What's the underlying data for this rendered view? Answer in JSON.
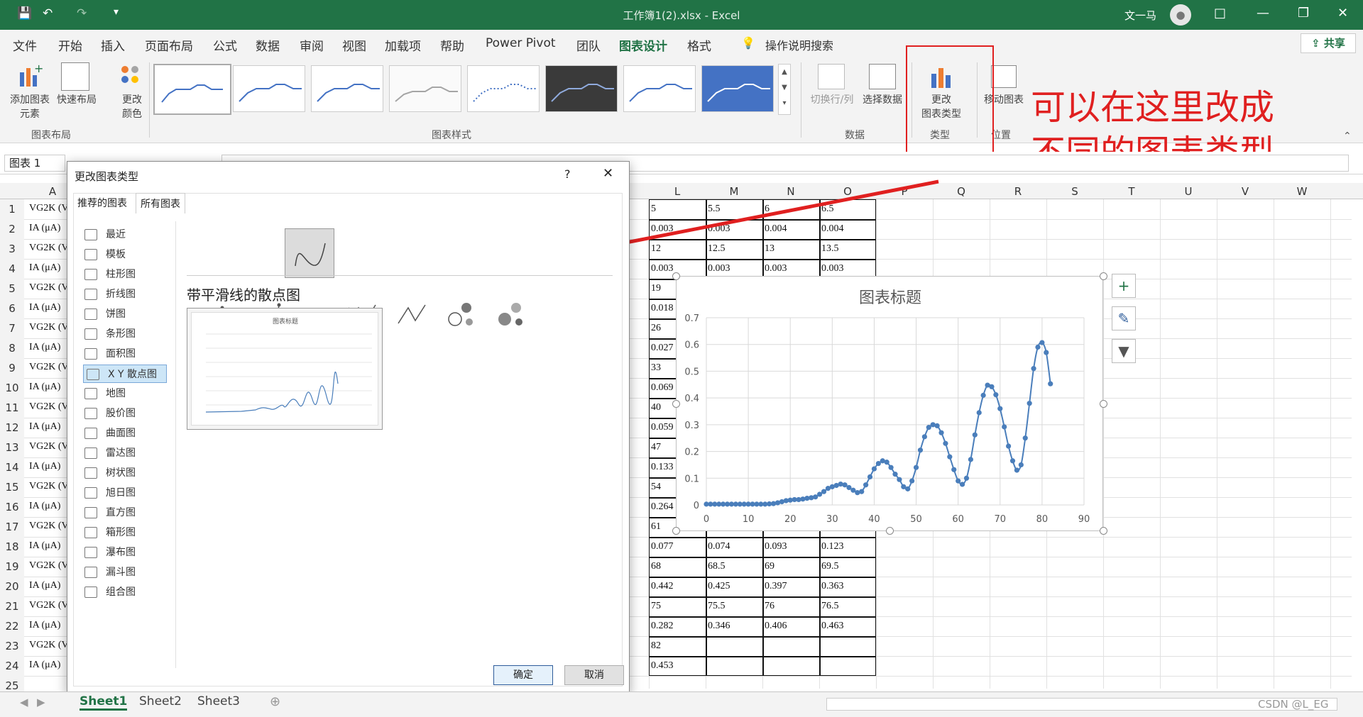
{
  "window": {
    "title": "工作簿1(2).xlsx  -  Excel",
    "user": "文一马"
  },
  "icons": {
    "save": "save-icon",
    "undo": "undo-icon",
    "redo": "redo-icon",
    "customize": "quick-access-dropdown-icon",
    "restore": "ribbon-display-icon",
    "minimize": "minimize-icon",
    "maximize": "maximize-icon",
    "close": "close-icon"
  },
  "tabs": [
    "文件",
    "开始",
    "插入",
    "页面布局",
    "公式",
    "数据",
    "审阅",
    "视图",
    "加载项",
    "帮助",
    "Power Pivot",
    "团队",
    "图表设计",
    "格式"
  ],
  "tell_me": "操作说明搜索",
  "share": "共享",
  "ribbon": {
    "add_element": "添加图表",
    "add_element2": "元素",
    "quick_layout": "快速布局",
    "change_colors": "更改",
    "change_colors2": "颜色",
    "group_layout": "图表布局",
    "group_styles": "图表样式",
    "switch_rowcol": "切换行/列",
    "select_data": "选择数据",
    "group_data": "数据",
    "change_type": "更改",
    "change_type2": "图表类型",
    "group_type": "类型",
    "move_chart": "移动图表",
    "group_location": "位置"
  },
  "annotation": {
    "line1": "可以在这里改成",
    "line2": "不同的图表类型"
  },
  "name_box": "图表 1",
  "dialog": {
    "title": "更改图表类型",
    "help": "?",
    "tab_recommended": "推荐的图表",
    "tab_all": "所有图表",
    "nav": [
      "最近",
      "模板",
      "柱形图",
      "折线图",
      "饼图",
      "条形图",
      "面积图",
      "X Y 散点图",
      "地图",
      "股价图",
      "曲面图",
      "雷达图",
      "树状图",
      "旭日图",
      "直方图",
      "箱形图",
      "瀑布图",
      "漏斗图",
      "组合图"
    ],
    "selected_nav": "X Y 散点图",
    "subtype_title": "带平滑线的散点图",
    "preview_title": "图表标题",
    "ok": "确定",
    "cancel": "取消"
  },
  "columns": [
    "A",
    "L",
    "M",
    "N",
    "O",
    "P",
    "Q",
    "R",
    "S",
    "T",
    "U",
    "V",
    "W"
  ],
  "rows": [
    "1",
    "2",
    "3",
    "4",
    "5",
    "6",
    "7",
    "8",
    "9",
    "10",
    "11",
    "12",
    "13",
    "14",
    "15",
    "16",
    "17",
    "18",
    "19",
    "20",
    "21",
    "22",
    "23",
    "24",
    "25"
  ],
  "col_a_labels": [
    "VG2K (V",
    "IA (μA)"
  ],
  "cells": {
    "L": [
      "5",
      "0.003",
      "12",
      "0.003",
      "19",
      "0.018",
      "26",
      "0.027",
      "33",
      "0.069",
      "40",
      "0.059",
      "47",
      "0.133",
      "54",
      "0.264",
      "61",
      "0.077",
      "68",
      "0.442",
      "75",
      "0.282",
      "82",
      "0.453"
    ],
    "M": [
      "5.5",
      "0.003",
      "12.5",
      "0.003",
      "",
      "",
      "",
      "",
      "",
      "",
      "",
      "",
      "",
      "",
      "",
      "",
      "",
      "0.074",
      "68.5",
      "0.425",
      "75.5",
      "0.346",
      "",
      ""
    ],
    "N": [
      "6",
      "0.004",
      "13",
      "0.003",
      "",
      "",
      "",
      "",
      "",
      "",
      "",
      "",
      "",
      "",
      "",
      "",
      "",
      "0.093",
      "69",
      "0.397",
      "76",
      "0.406",
      "",
      ""
    ],
    "O": [
      "6.5",
      "0.004",
      "13.5",
      "0.003",
      "",
      "",
      "",
      "",
      "",
      "",
      "",
      "",
      "",
      "",
      "",
      "",
      "",
      "0.123",
      "69.5",
      "0.363",
      "76.5",
      "0.463",
      "",
      ""
    ]
  },
  "sheets": [
    "Sheet1",
    "Sheet2",
    "Sheet3"
  ],
  "active_sheet": "Sheet1",
  "watermark": "CSDN @L_EG",
  "chart_data": {
    "type": "scatter",
    "title": "图表标题",
    "xlim": [
      0,
      90
    ],
    "ylim": [
      0,
      0.7
    ],
    "x_ticks": [
      0,
      10,
      20,
      30,
      40,
      50,
      60,
      70,
      80,
      90
    ],
    "y_ticks": [
      0,
      0.1,
      0.2,
      0.3,
      0.4,
      0.5,
      0.6,
      0.7
    ],
    "grid": true,
    "smooth_lines": true,
    "color": "#4a7ebb",
    "series": [
      {
        "x": [
          0,
          1,
          2,
          3,
          4,
          5,
          6,
          7,
          8,
          9,
          10,
          11,
          12,
          13,
          14,
          15,
          16,
          17,
          18,
          19,
          20,
          21,
          22,
          23,
          24,
          25,
          26,
          27,
          28,
          29,
          30,
          31,
          32,
          33,
          34,
          35,
          36,
          37,
          38,
          39,
          40,
          41,
          42,
          43,
          44,
          45,
          46,
          47,
          48,
          49,
          50,
          51,
          52,
          53,
          54,
          55,
          56,
          57,
          58,
          59,
          60,
          61,
          62,
          63,
          64,
          65,
          66,
          67,
          68,
          69,
          70,
          71,
          72,
          73,
          74,
          75,
          76,
          77,
          78,
          79,
          80,
          81,
          82
        ],
        "y": [
          0.003,
          0.003,
          0.003,
          0.003,
          0.003,
          0.003,
          0.003,
          0.003,
          0.003,
          0.003,
          0.003,
          0.003,
          0.003,
          0.003,
          0.003,
          0.004,
          0.005,
          0.008,
          0.012,
          0.016,
          0.018,
          0.02,
          0.02,
          0.022,
          0.025,
          0.027,
          0.03,
          0.04,
          0.05,
          0.062,
          0.068,
          0.073,
          0.078,
          0.075,
          0.065,
          0.055,
          0.046,
          0.05,
          0.075,
          0.105,
          0.135,
          0.155,
          0.165,
          0.16,
          0.14,
          0.115,
          0.095,
          0.068,
          0.06,
          0.09,
          0.14,
          0.205,
          0.255,
          0.29,
          0.3,
          0.296,
          0.27,
          0.23,
          0.18,
          0.132,
          0.09,
          0.077,
          0.1,
          0.17,
          0.262,
          0.345,
          0.41,
          0.448,
          0.442,
          0.412,
          0.36,
          0.292,
          0.22,
          0.165,
          0.13,
          0.15,
          0.25,
          0.38,
          0.51,
          0.59,
          0.607,
          0.57,
          0.453
        ]
      }
    ]
  }
}
